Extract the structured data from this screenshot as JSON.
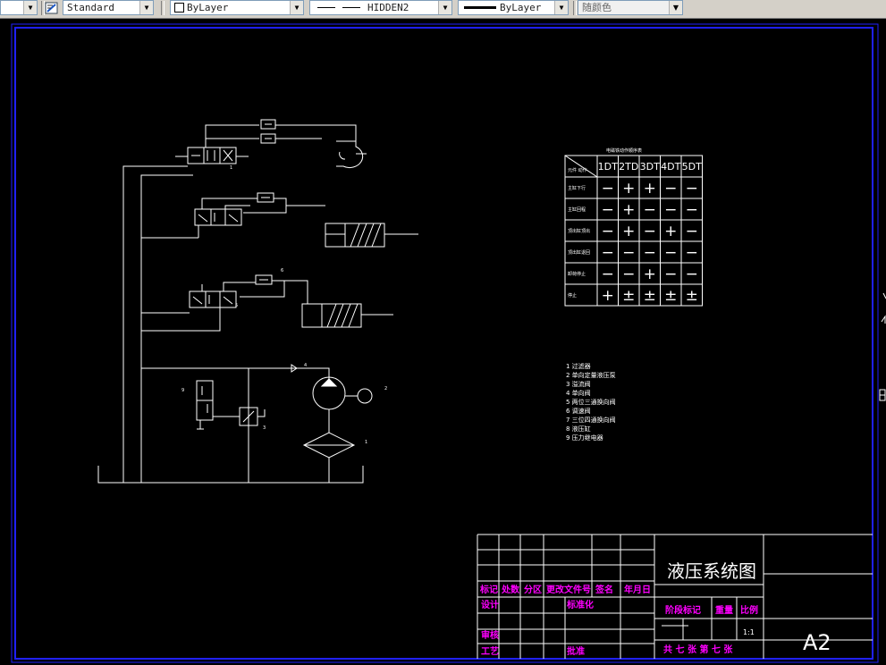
{
  "toolbar": {
    "first_combo_value": "",
    "text_style": "Standard",
    "color_value": "ByLayer",
    "linetype_value": "HIDDEN2",
    "lineweight_value": "ByLayer",
    "plot_style_value": "随颜色"
  },
  "table": {
    "caption": "电磁铁动作顺序表",
    "header_corner": "元件 动作",
    "columns": [
      "1DT",
      "2TD",
      "3DT",
      "4DT",
      "5DT"
    ],
    "rows": [
      {
        "label": "主缸下行",
        "cells": [
          "−",
          "+",
          "+",
          "−",
          "−"
        ]
      },
      {
        "label": "主缸回程",
        "cells": [
          "−",
          "+",
          "−",
          "−",
          "−"
        ]
      },
      {
        "label": "顶出缸顶出",
        "cells": [
          "−",
          "+",
          "−",
          "+",
          "−"
        ]
      },
      {
        "label": "顶出缸退回",
        "cells": [
          "−",
          "−",
          "−",
          "−",
          "−"
        ]
      },
      {
        "label": "卸荷停止",
        "cells": [
          "−",
          "−",
          "+",
          "−",
          "−"
        ]
      },
      {
        "label": "停止",
        "cells": [
          "+",
          "±",
          "±",
          "±",
          "±"
        ]
      }
    ]
  },
  "parts_list": [
    "1 过滤器",
    "2 单向定量液压泵",
    "3 溢流阀",
    "4 单向阀",
    "5 两位三通换向阀",
    "6 调速阀",
    "7 三位四通换向阀",
    "8 液压缸",
    "9 压力继电器"
  ],
  "title_block": {
    "title": "液压系统图",
    "headers": [
      "标记",
      "处数",
      "分区",
      "更改文件号",
      "签名",
      "年月日"
    ],
    "design": "设计",
    "standardize": "标准化",
    "review": "审核",
    "process": "工艺",
    "approve": "批准",
    "stage_mark": "阶段标记",
    "weight": "重量",
    "scale": "比例",
    "scale_value": "1:1",
    "sheets": "共 七  张 第 七 张",
    "size": "A2"
  }
}
